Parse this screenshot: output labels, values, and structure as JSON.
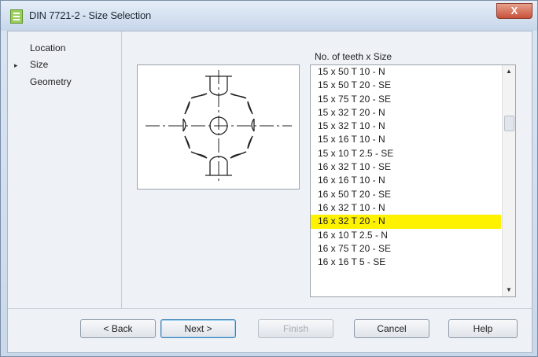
{
  "window": {
    "title": "DIN 7721-2 - Size Selection",
    "close_label": "X"
  },
  "nav": {
    "items": [
      {
        "label": "Location",
        "current": false
      },
      {
        "label": "Size",
        "current": true
      },
      {
        "label": "Geometry",
        "current": false
      }
    ],
    "current_marker": "▸"
  },
  "list": {
    "caption": "No. of teeth x Size",
    "items": [
      "15 x 50 T 10 - N",
      "15 x 50 T 20 - SE",
      "15 x 75 T 20 - SE",
      "15 x 32 T 20 - N",
      "15 x 32 T 10 - N",
      "15 x 16 T 10 - N",
      "15 x 10 T 2.5 - SE",
      "16 x 32 T 10 - SE",
      "16 x 16 T 10 - N",
      "16 x 50 T 20 - SE",
      "16 x 32 T 10 - N",
      "16 x 32 T 20 - N",
      "16 x 10 T 2.5 - N",
      "16 x 75 T 20 - SE",
      "16 x 16 T 5 - SE"
    ],
    "selected_index": 11,
    "highlight_color": "#fff200"
  },
  "buttons": {
    "back": "< Back",
    "next": "Next >",
    "finish": "Finish",
    "cancel": "Cancel",
    "help": "Help"
  }
}
